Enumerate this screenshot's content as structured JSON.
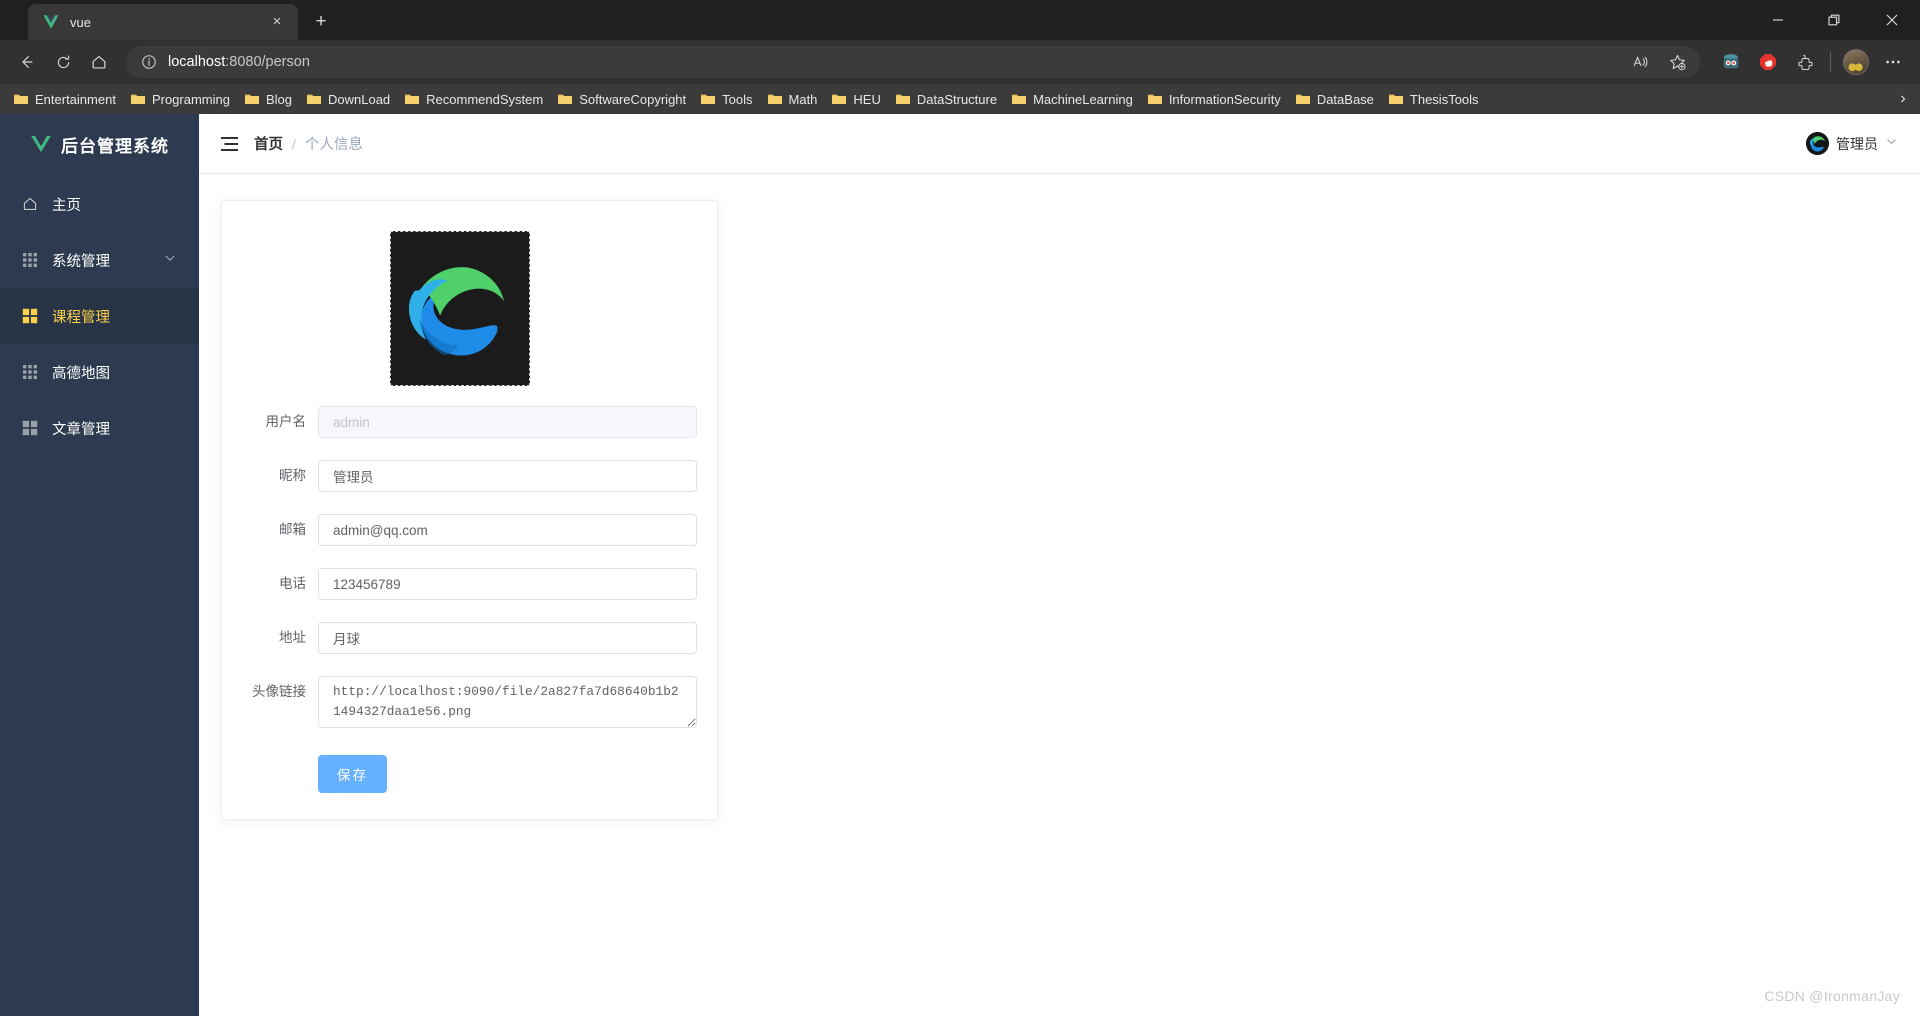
{
  "browser": {
    "tab": {
      "title": "vue",
      "favicon": "vue-logo-icon",
      "close": "×"
    },
    "new_tab_label": "+",
    "window_controls": {
      "minimize": "minimize-icon",
      "restore": "restore-icon",
      "close": "close-icon"
    },
    "nav": {
      "back": "back-arrow-icon",
      "reload": "reload-icon",
      "home": "home-icon"
    },
    "address": {
      "info_icon": "site-info-icon",
      "host": "localhost",
      "path": ":8080/person",
      "full_url": "localhost:8080/person"
    },
    "omnibox_actions": {
      "read_aloud": "read-aloud-icon",
      "favorite": "star-plus-icon"
    },
    "toolbar_right": {
      "bot_extension": "bot-extension-icon",
      "adblock": "adblock-icon",
      "extensions": "extensions-puzzle-icon",
      "profile": "profile-avatar",
      "settings_more": "more-menu-icon"
    },
    "bookmarks": [
      {
        "label": "Entertainment"
      },
      {
        "label": "Programming"
      },
      {
        "label": "Blog"
      },
      {
        "label": "DownLoad"
      },
      {
        "label": "RecommendSystem"
      },
      {
        "label": "SoftwareCopyright"
      },
      {
        "label": "Tools"
      },
      {
        "label": "Math"
      },
      {
        "label": "HEU"
      },
      {
        "label": "DataStructure"
      },
      {
        "label": "MachineLearning"
      },
      {
        "label": "InformationSecurity"
      },
      {
        "label": "DataBase"
      },
      {
        "label": "ThesisTools"
      }
    ],
    "bookmarks_overflow": "›"
  },
  "sidebar": {
    "logo_text": "后台管理系统",
    "logo_icon": "vue-logo-icon",
    "items": [
      {
        "label": "主页",
        "icon": "home-outline-icon",
        "active": false,
        "expandable": false
      },
      {
        "label": "系统管理",
        "icon": "grid-icon",
        "active": false,
        "expandable": true
      },
      {
        "label": "课程管理",
        "icon": "squares-icon",
        "active": true,
        "expandable": false
      },
      {
        "label": "高德地图",
        "icon": "grid-icon",
        "active": false,
        "expandable": false
      },
      {
        "label": "文章管理",
        "icon": "squares-icon",
        "active": false,
        "expandable": false
      }
    ]
  },
  "topbar": {
    "collapse_icon": "hamburger-menu-icon",
    "breadcrumb_home": "首页",
    "breadcrumb_sep": "/",
    "breadcrumb_current": "个人信息",
    "user_name": "管理员",
    "user_avatar": "edge-logo-avatar",
    "user_chevron": "chevron-down-icon"
  },
  "form": {
    "avatar_alt": "edge-logo-avatar",
    "fields": [
      {
        "label": "用户名",
        "value": "admin",
        "disabled": true,
        "type": "text"
      },
      {
        "label": "昵称",
        "value": "管理员",
        "disabled": false,
        "type": "text"
      },
      {
        "label": "邮箱",
        "value": "admin@qq.com",
        "disabled": false,
        "type": "text"
      },
      {
        "label": "电话",
        "value": "123456789",
        "disabled": false,
        "type": "text"
      },
      {
        "label": "地址",
        "value": "月球",
        "disabled": false,
        "type": "text"
      },
      {
        "label": "头像链接",
        "value": "http://localhost:9090/file/2a827fa7d68640b1b21494327daa1e56.png",
        "disabled": false,
        "type": "textarea"
      }
    ],
    "save_label": "保存"
  },
  "watermark": "CSDN @IronmanJay",
  "colors": {
    "sidebar_bg": "#2d3a4f",
    "sidebar_active_bg": "#263445",
    "sidebar_active_text": "#ffd04b",
    "primary_button": "#66b1ff",
    "vue_green": "#41b883",
    "vue_dark": "#35495e"
  }
}
